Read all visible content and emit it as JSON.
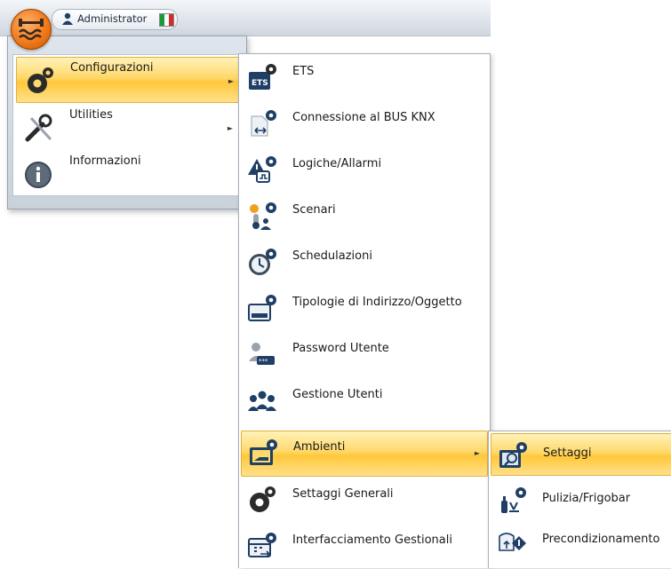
{
  "user": {
    "name": "Administrator"
  },
  "main_menu": {
    "items": [
      {
        "label": "Configurazioni",
        "icon": "gear-icon",
        "has_submenu": true,
        "active": true
      },
      {
        "label": "Utilities",
        "icon": "tools-icon",
        "has_submenu": true,
        "active": false
      },
      {
        "label": "Informazioni",
        "icon": "info-icon",
        "has_submenu": false,
        "active": false
      }
    ]
  },
  "config_submenu": {
    "items": [
      {
        "label": "ETS",
        "icon": "ets-icon"
      },
      {
        "label": "Connessione al BUS KNX",
        "icon": "bus-connection-icon"
      },
      {
        "label": "Logiche/Allarmi",
        "icon": "logic-alarm-icon"
      },
      {
        "label": "Scenari",
        "icon": "scenario-icon"
      },
      {
        "label": "Schedulazioni",
        "icon": "clock-icon"
      },
      {
        "label": "Tipologie di Indirizzo/Oggetto",
        "icon": "address-type-icon"
      },
      {
        "label": "Password Utente",
        "icon": "user-password-icon"
      },
      {
        "label": "Gestione Utenti",
        "icon": "users-icon"
      },
      {
        "label": "Ambienti",
        "icon": "room-icon",
        "has_submenu": true,
        "active": true
      },
      {
        "label": "Settaggi Generali",
        "icon": "gear-icon"
      },
      {
        "label": "Interfacciamento Gestionali",
        "icon": "calendar-interface-icon"
      }
    ]
  },
  "ambienti_submenu": {
    "items": [
      {
        "label": "Settaggi",
        "icon": "settings-search-icon",
        "active": true
      },
      {
        "label": "Pulizia/Frigobar",
        "icon": "cleaning-icon"
      },
      {
        "label": "Precondizionamento",
        "icon": "preconditioning-icon"
      }
    ]
  },
  "colors": {
    "highlight": "#ffd86b",
    "accent": "#f07a1c",
    "icon_blue": "#1f3f66"
  }
}
